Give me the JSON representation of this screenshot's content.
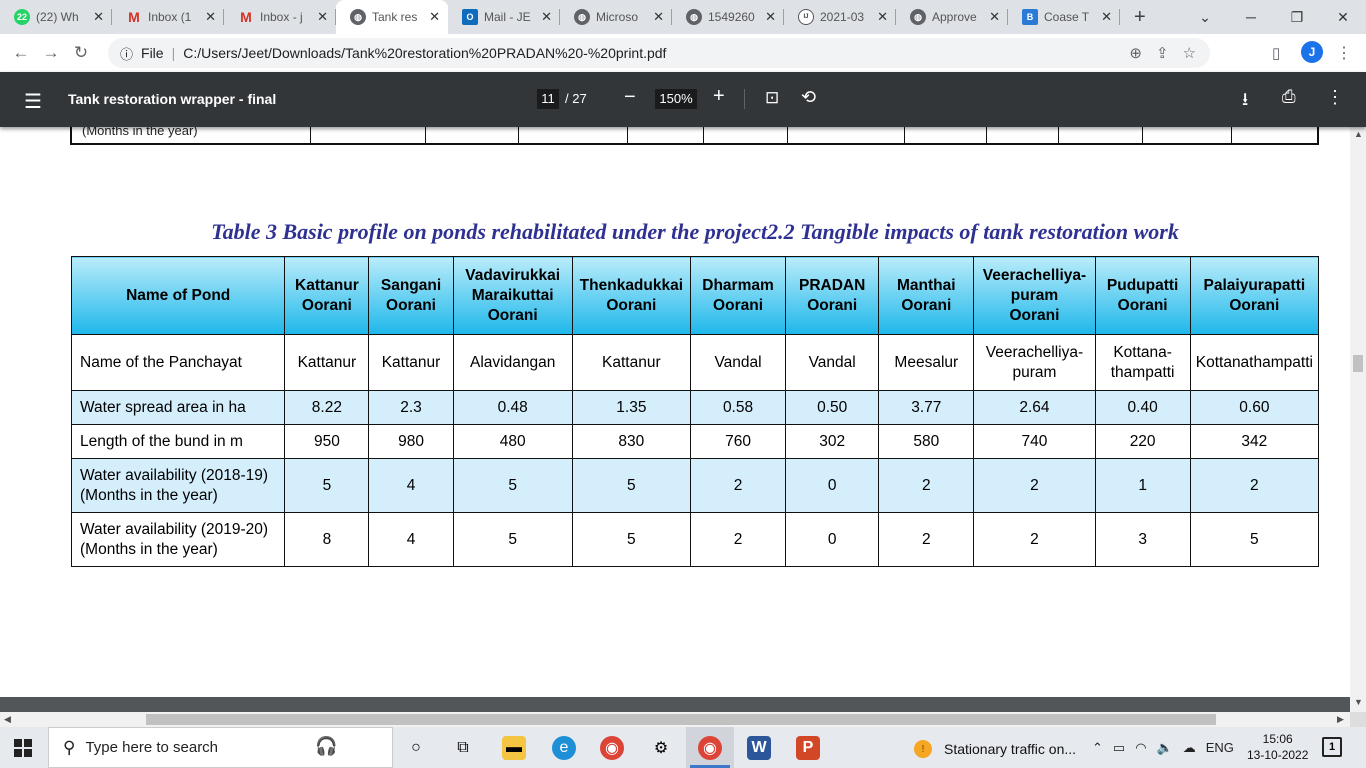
{
  "browser": {
    "tabs": [
      {
        "title": "(22) Wh",
        "favicon": "whatsapp-icon",
        "badge": "22"
      },
      {
        "title": "Inbox (1",
        "favicon": "gmail-icon"
      },
      {
        "title": "Inbox - j",
        "favicon": "gmail-icon"
      },
      {
        "title": "Tank res",
        "favicon": "globe-icon",
        "active": true
      },
      {
        "title": "Mail - JE",
        "favicon": "outlook-icon"
      },
      {
        "title": "Microso",
        "favicon": "globe-icon"
      },
      {
        "title": "1549260",
        "favicon": "globe-icon"
      },
      {
        "title": "2021-03",
        "favicon": "ijrdo-icon"
      },
      {
        "title": "Approve",
        "favicon": "globe-icon"
      },
      {
        "title": "Coase T",
        "favicon": "b-icon"
      }
    ],
    "address": {
      "scheme_label": "File",
      "url": "C:/Users/Jeet/Downloads/Tank%20restoration%20PRADAN%20-%20print.pdf"
    },
    "profile_initial": "J"
  },
  "pdf": {
    "title": "Tank restoration wrapper - final",
    "current_page": "11",
    "total_pages": "/ 27",
    "zoom": "150%"
  },
  "document": {
    "prev_row_text": "(Months in the year)",
    "caption": "Table 3 Basic profile on ponds rehabilitated under the project2.2 Tangible impacts of tank restoration work",
    "table": {
      "headers": [
        [
          "Name of Pond"
        ],
        [
          "Kattanur",
          "Oorani"
        ],
        [
          "Sangani",
          "Oorani"
        ],
        [
          "Vadavirukkai",
          "Maraikuttai",
          "Oorani"
        ],
        [
          "Thenkadukkai",
          "Oorani"
        ],
        [
          "Dharmam",
          "Oorani"
        ],
        [
          "PRADAN",
          "Oorani"
        ],
        [
          "Manthai",
          "Oorani"
        ],
        [
          "Veerachelliya-",
          "puram",
          "Oorani"
        ],
        [
          "Pudupatti",
          "Oorani"
        ],
        [
          "Palaiyurapatti",
          "Oorani"
        ]
      ],
      "rows": [
        {
          "label": [
            "Name of the Panchayat"
          ],
          "style": "plain",
          "cells": [
            [
              "Kattanur"
            ],
            [
              "Kattanur"
            ],
            [
              "Alavidangan"
            ],
            [
              "Kattanur"
            ],
            [
              "Vandal"
            ],
            [
              "Vandal"
            ],
            [
              "Meesalur"
            ],
            [
              "Veerachelliya-",
              "puram"
            ],
            [
              "Kottana-",
              "thampatti"
            ],
            [
              "Kottanathampatti"
            ]
          ]
        },
        {
          "label": [
            "Water spread area in ha"
          ],
          "style": "blue",
          "cells": [
            [
              "8.22"
            ],
            [
              "2.3"
            ],
            [
              "0.48"
            ],
            [
              "1.35"
            ],
            [
              "0.58"
            ],
            [
              "0.50"
            ],
            [
              "3.77"
            ],
            [
              "2.64"
            ],
            [
              "0.40"
            ],
            [
              "0.60"
            ]
          ]
        },
        {
          "label": [
            "Length of the bund in m"
          ],
          "style": "plain",
          "cells": [
            [
              "950"
            ],
            [
              "980"
            ],
            [
              "480"
            ],
            [
              "830"
            ],
            [
              "760"
            ],
            [
              "302"
            ],
            [
              "580"
            ],
            [
              "740"
            ],
            [
              "220"
            ],
            [
              "342"
            ]
          ]
        },
        {
          "label": [
            "Water availability (2018-19)",
            "(Months in the year)"
          ],
          "style": "blue",
          "cells": [
            [
              "5"
            ],
            [
              "4"
            ],
            [
              "5"
            ],
            [
              "5"
            ],
            [
              "2"
            ],
            [
              "0"
            ],
            [
              "2"
            ],
            [
              "2"
            ],
            [
              "1"
            ],
            [
              "2"
            ]
          ]
        },
        {
          "label": [
            "Water availability (2019-20)",
            "(Months in the year)"
          ],
          "style": "plain",
          "cells": [
            [
              "8"
            ],
            [
              "4"
            ],
            [
              "5"
            ],
            [
              "5"
            ],
            [
              "2"
            ],
            [
              "0"
            ],
            [
              "2"
            ],
            [
              "2"
            ],
            [
              "3"
            ],
            [
              "5"
            ]
          ]
        }
      ]
    }
  },
  "taskbar": {
    "search_placeholder": "Type here to search",
    "weather_text": "Stationary traffic on...",
    "language": "ENG",
    "time": "15:06",
    "date": "13-10-2022",
    "notification_count": "1"
  },
  "colors": {
    "header_gradient_top": "#b9ecfa",
    "header_gradient_bottom": "#1eb7ea",
    "row_blue": "#d5eefb",
    "caption": "#2e3192",
    "pdf_toolbar": "#323639"
  }
}
